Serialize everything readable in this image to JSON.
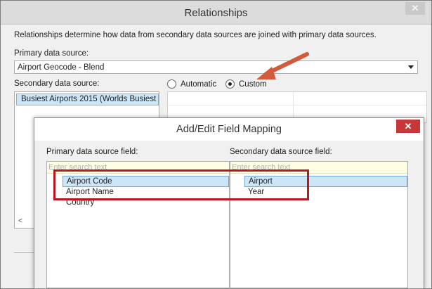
{
  "window": {
    "title": "Relationships",
    "close_glyph": "✕"
  },
  "relationships": {
    "description": "Relationships determine how data from secondary data sources are joined with primary data sources.",
    "primary_label": "Primary data source:",
    "primary_value": "Airport Geocode - Blend",
    "secondary_label": "Secondary data source:",
    "secondary_items": [
      "Busiest Airports 2015 (Worlds Busiest Air"
    ],
    "scroll_left_glyph": "<",
    "radio_automatic": "Automatic",
    "radio_custom": "Custom",
    "selected_mode": "Custom"
  },
  "dialog": {
    "title": "Add/Edit Field Mapping",
    "close_glyph": "✕",
    "primary_label": "Primary data source field:",
    "secondary_label": "Secondary data source field:",
    "search_placeholder": "Enter search text",
    "primary_fields": [
      "Airport Code",
      "Airport Name",
      "Country"
    ],
    "primary_selected": "Airport Code",
    "secondary_fields": [
      "Airport",
      "Year"
    ],
    "secondary_selected": "Airport"
  },
  "colors": {
    "annotation": "#b61a1f",
    "arrow": "#d35a3a",
    "selection": "#cde6f7"
  }
}
